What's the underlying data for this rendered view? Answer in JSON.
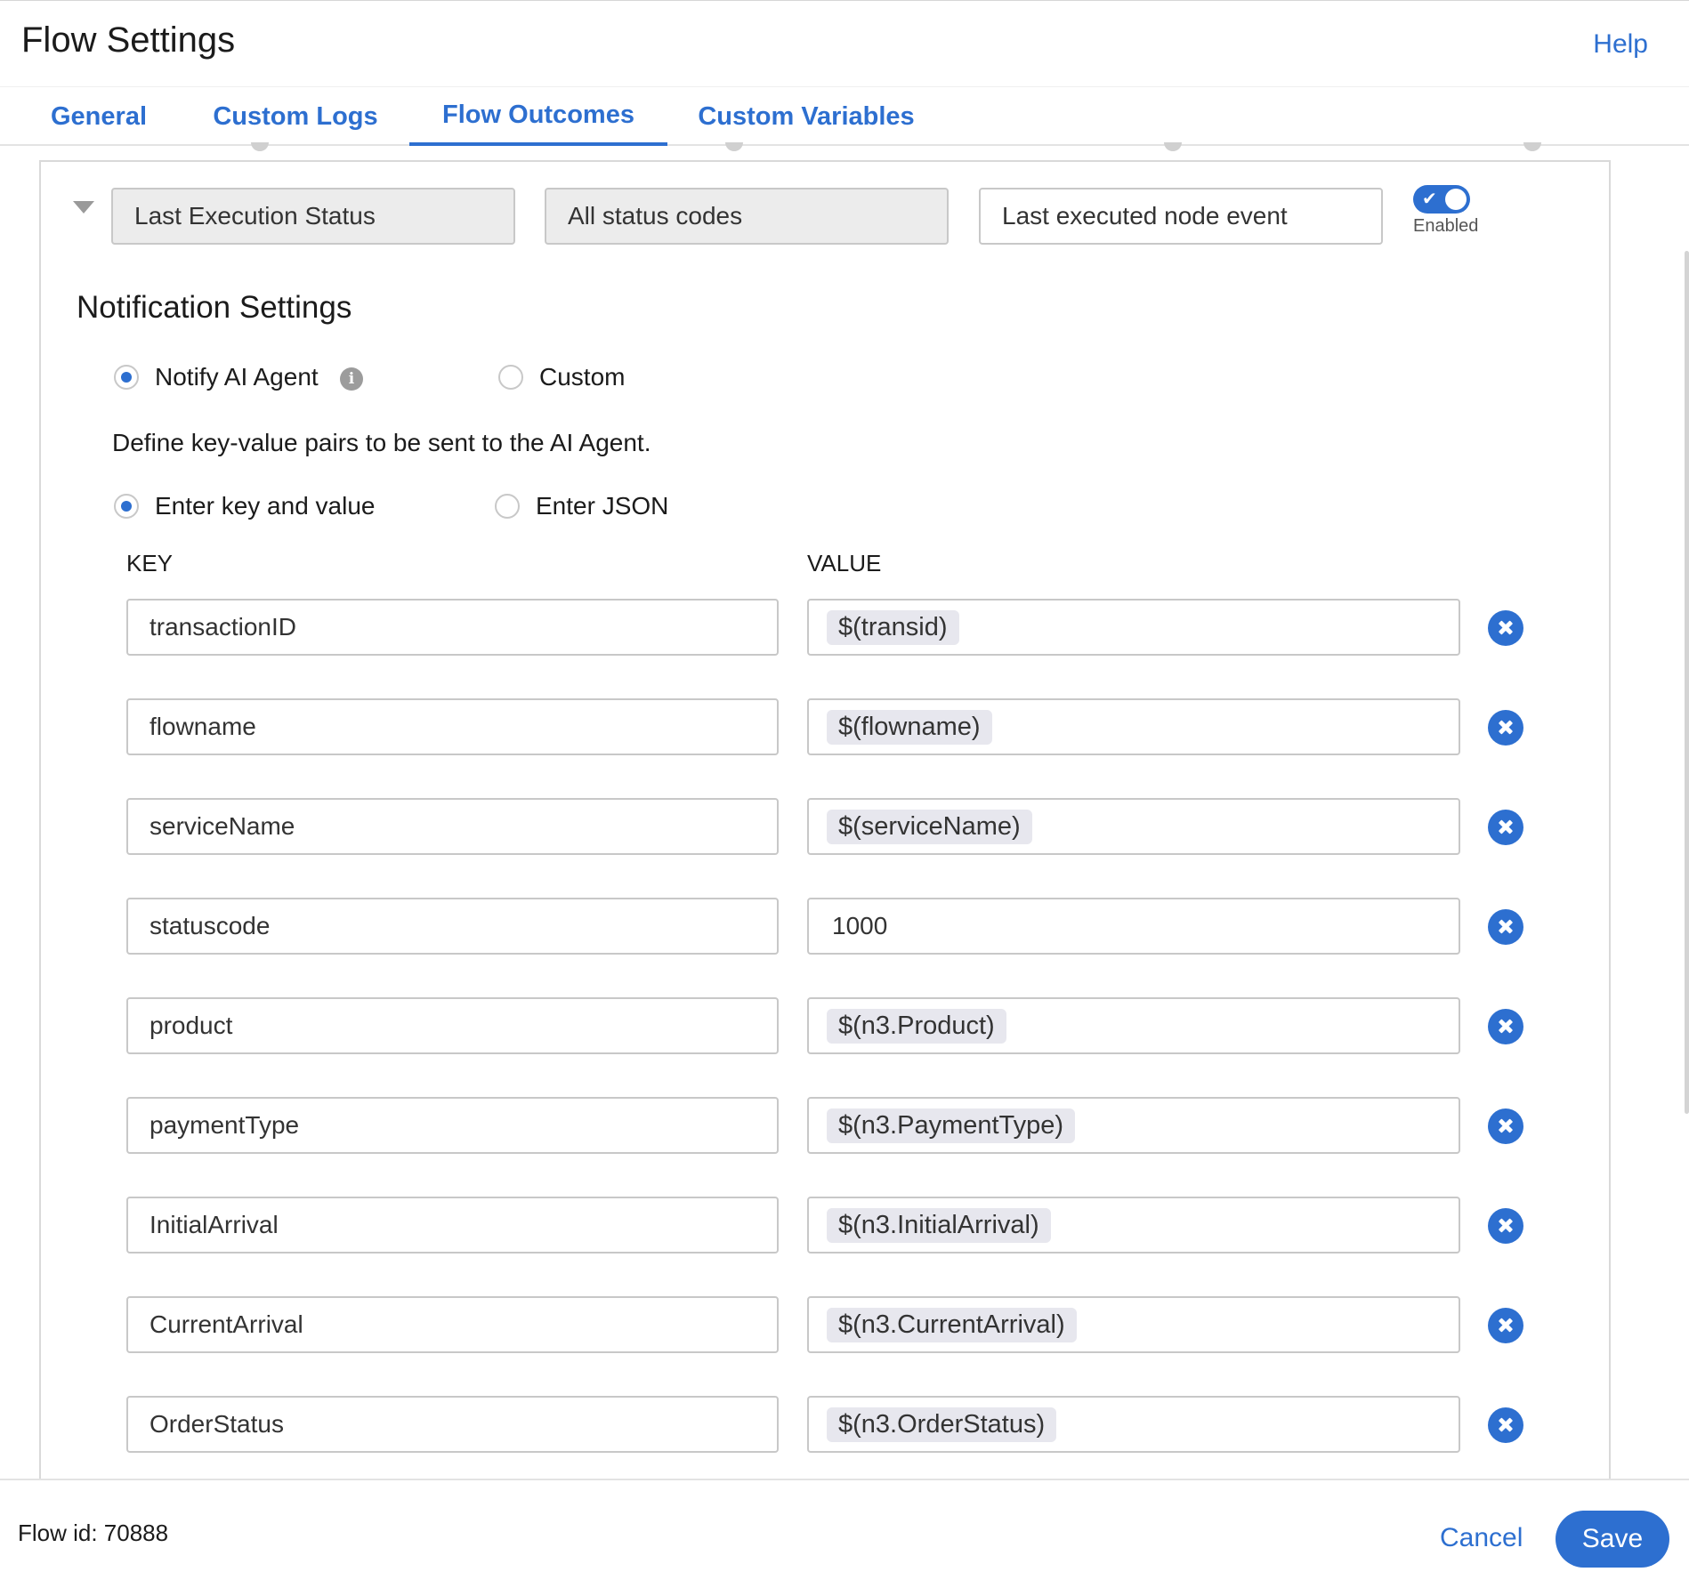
{
  "header": {
    "title": "Flow Settings",
    "help": "Help"
  },
  "tabs": [
    {
      "label": "General"
    },
    {
      "label": "Custom Logs"
    },
    {
      "label": "Flow Outcomes"
    },
    {
      "label": "Custom Variables"
    }
  ],
  "outcome": {
    "condition": "Last Execution Status",
    "status_codes": "All status codes",
    "event": "Last executed node event",
    "toggle_label": "Enabled",
    "enabled": true
  },
  "notification": {
    "title": "Notification Settings",
    "notify_ai_agent": "Notify AI Agent",
    "custom": "Custom",
    "description": "Define key-value pairs to be sent to the AI Agent.",
    "enter_key_value": "Enter key and value",
    "enter_json": "Enter JSON",
    "key_header": "KEY",
    "value_header": "VALUE",
    "pairs": [
      {
        "key": "transactionID",
        "value": "$(transid)"
      },
      {
        "key": "flowname",
        "value": "$(flowname)"
      },
      {
        "key": "serviceName",
        "value": "$(serviceName)"
      },
      {
        "key": "statuscode",
        "value": "1000"
      },
      {
        "key": "product",
        "value": "$(n3.Product)"
      },
      {
        "key": "paymentType",
        "value": "$(n3.PaymentType)"
      },
      {
        "key": "InitialArrival",
        "value": "$(n3.InitialArrival)"
      },
      {
        "key": "CurrentArrival",
        "value": "$(n3.CurrentArrival)"
      },
      {
        "key": "OrderStatus",
        "value": "$(n3.OrderStatus)"
      }
    ]
  },
  "footer": {
    "flow_id": "Flow id: 70888",
    "cancel": "Cancel",
    "save": "Save"
  },
  "colors": {
    "accent": "#2d6fd0",
    "border": "#c8c8c8",
    "chip": "#e7e7ee"
  }
}
